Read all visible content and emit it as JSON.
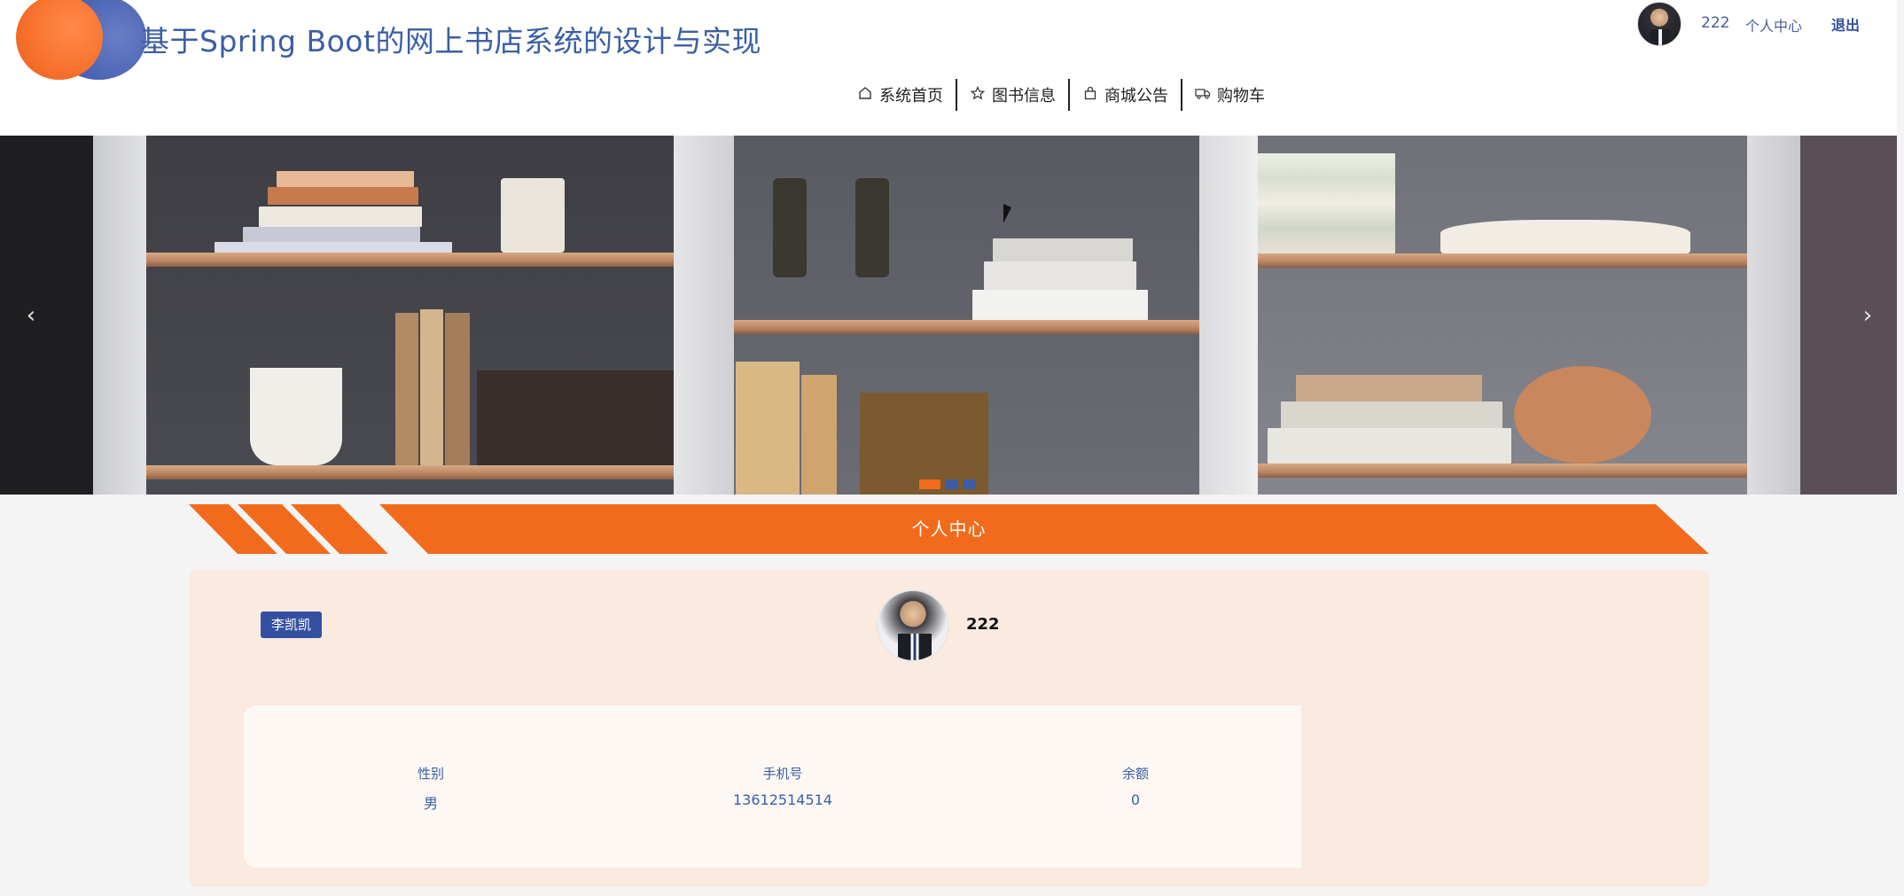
{
  "header": {
    "site_title": "基于Spring Boot的网上书店系统的设计与实现",
    "username": "222",
    "personal_center": "个人中心",
    "logout": "退出"
  },
  "nav": [
    {
      "label": "系统首页",
      "icon": "home-icon"
    },
    {
      "label": "图书信息",
      "icon": "star-icon"
    },
    {
      "label": "商城公告",
      "icon": "bag-icon"
    },
    {
      "label": "购物车",
      "icon": "truck-icon"
    }
  ],
  "banner": {
    "prev": "‹",
    "next": "›",
    "slide_count": 3,
    "active_slide": 1
  },
  "section": {
    "title": "个人中心"
  },
  "profile": {
    "name_tag": "李凯凯",
    "username": "222",
    "fields": [
      {
        "label": "性别",
        "value": "男"
      },
      {
        "label": "手机号",
        "value": "13612514514"
      },
      {
        "label": "余额",
        "value": "0"
      }
    ]
  },
  "colors": {
    "accent_orange": "#f26b1d",
    "brand_blue": "#3b5fa3",
    "card_bg": "#fbeae0"
  }
}
